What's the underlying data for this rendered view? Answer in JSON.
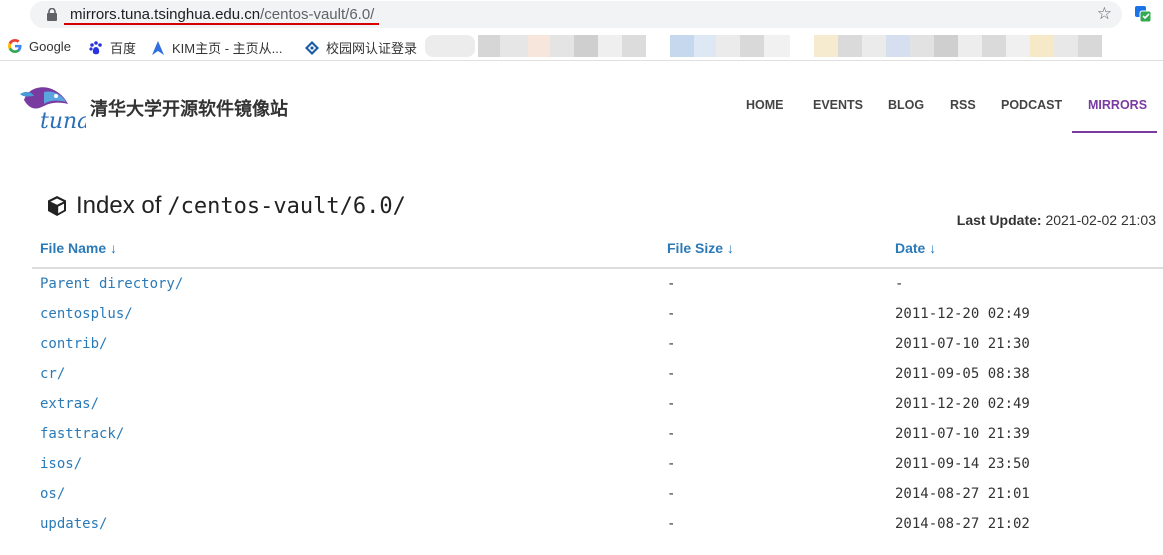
{
  "browser": {
    "url_host": "mirrors.tuna.tsinghua.edu.cn",
    "url_path": "/centos-vault/6.0/",
    "bookmarks": [
      {
        "label": "Google",
        "icon": "google-icon"
      },
      {
        "label": "百度",
        "icon": "baidu-paw-icon"
      },
      {
        "label": "KIM主页 - 主页从...",
        "icon": "kim-arrow-icon"
      },
      {
        "label": "校园网认证登录",
        "icon": "campus-network-icon"
      }
    ]
  },
  "site": {
    "logo_text": "tuna",
    "title": "清华大学开源软件镜像站",
    "nav": [
      "HOME",
      "EVENTS",
      "BLOG",
      "RSS",
      "PODCAST",
      "MIRRORS"
    ],
    "active_nav": "MIRRORS",
    "accent_color": "#7a3ba1",
    "link_color": "#2a7ab8"
  },
  "index": {
    "title_prefix": "Index of",
    "title_path": "/centos-vault/6.0/",
    "last_update_label": "Last Update:",
    "last_update_value": "2021-02-02 21:03"
  },
  "table": {
    "headers": [
      "File Name ↓",
      "File Size ↓",
      "Date ↓"
    ],
    "rows": [
      {
        "name": "Parent directory/",
        "size": "-",
        "date": "-"
      },
      {
        "name": "centosplus/",
        "size": "-",
        "date": "2011-12-20 02:49"
      },
      {
        "name": "contrib/",
        "size": "-",
        "date": "2011-07-10 21:30"
      },
      {
        "name": "cr/",
        "size": "-",
        "date": "2011-09-05 08:38"
      },
      {
        "name": "extras/",
        "size": "-",
        "date": "2011-12-20 02:49"
      },
      {
        "name": "fasttrack/",
        "size": "-",
        "date": "2011-07-10 21:39"
      },
      {
        "name": "isos/",
        "size": "-",
        "date": "2011-09-14 23:50"
      },
      {
        "name": "os/",
        "size": "-",
        "date": "2014-08-27 21:01"
      },
      {
        "name": "updates/",
        "size": "-",
        "date": "2014-08-27 21:02"
      }
    ]
  }
}
